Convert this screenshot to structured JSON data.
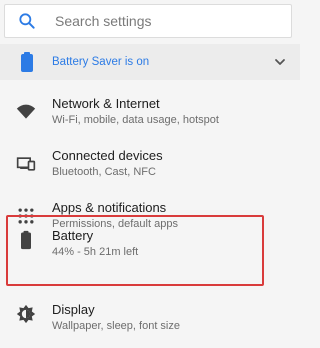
{
  "search": {
    "placeholder": "Search settings",
    "icon": "search-icon"
  },
  "banner": {
    "text": "Battery Saver is on",
    "accent": "#2c7be5"
  },
  "items": [
    {
      "title": "Network & Internet",
      "subtitle": "Wi-Fi, mobile, data usage, hotspot",
      "icon": "wifi-icon"
    },
    {
      "title": "Connected devices",
      "subtitle": "Bluetooth, Cast, NFC",
      "icon": "devices-icon"
    },
    {
      "title": "Apps & notifications",
      "subtitle": "Permissions, default apps",
      "icon": "apps-grid-icon"
    },
    {
      "title": "Battery",
      "subtitle": "44% - 5h 21m left",
      "icon": "battery-icon",
      "highlighted": true
    },
    {
      "title": "Display",
      "subtitle": "Wallpaper, sleep, font size",
      "icon": "brightness-icon"
    }
  ],
  "highlight_color": "#d93b3b"
}
